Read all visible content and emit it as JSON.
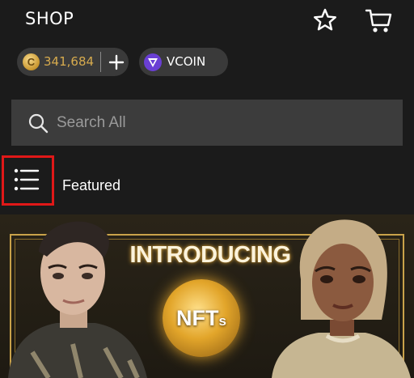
{
  "header": {
    "title": "SHOP",
    "favorites_icon": "star-icon",
    "cart_icon": "cart-icon"
  },
  "wallet": {
    "credits_icon": "credits-coin-icon",
    "credits_symbol": "C",
    "credits_amount": "341,684",
    "add_icon": "plus-icon",
    "vcoin_icon": "vcoin-icon",
    "vcoin_label": "VCOIN"
  },
  "search": {
    "icon": "search-icon",
    "placeholder": "Search All",
    "value": ""
  },
  "category_bar": {
    "menu_icon": "list-menu-icon",
    "label": "Featured"
  },
  "banner": {
    "heading": "INTRODUCING",
    "badge_text": "NFT",
    "badge_suffix": "s"
  },
  "colors": {
    "background": "#1b1b1b",
    "pill": "#3a3a3a",
    "credits_gold": "#d7ab4e",
    "vcoin_purple": "#6a3fd4",
    "highlight_red": "#e01818"
  }
}
